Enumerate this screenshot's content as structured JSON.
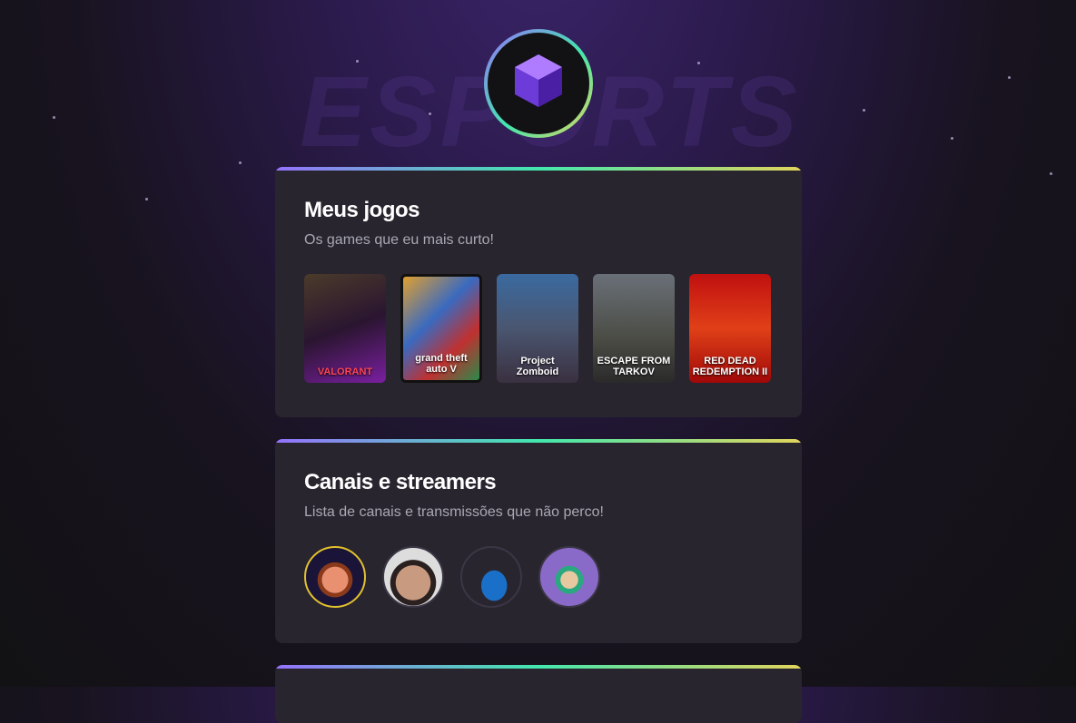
{
  "background": {
    "watermark": "ESPORTS"
  },
  "colors": {
    "accent_start": "#9572fc",
    "accent_mid": "#43e7ad",
    "accent_end": "#e2d45c",
    "card": "#29252f"
  },
  "games_section": {
    "title": "Meus jogos",
    "subtitle": "Os games que eu mais curto!",
    "games": [
      {
        "label": "VALORANT"
      },
      {
        "label": "grand theft auto V"
      },
      {
        "label": "Project Zomboid"
      },
      {
        "label": "ESCAPE FROM TARKOV"
      },
      {
        "label": "RED DEAD REDEMPTION II"
      }
    ]
  },
  "streamers_section": {
    "title": "Canais e streamers",
    "subtitle": "Lista de canais e transmissões que não perco!"
  }
}
